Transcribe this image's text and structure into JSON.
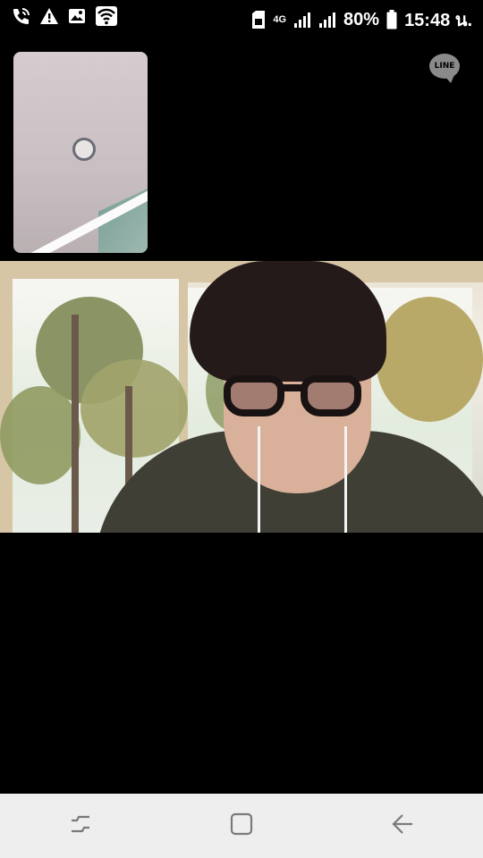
{
  "status_bar": {
    "battery_percent": "80%",
    "time": "15:48 น.",
    "network_type": "4G",
    "left_icons": [
      "wifi-calling-icon",
      "warning-icon",
      "image-icon",
      "wifi-icon"
    ],
    "right_icons": [
      "sim-icon",
      "signal-icon",
      "signal-icon",
      "battery-icon"
    ]
  },
  "call": {
    "app_logo_text": "LINE"
  },
  "navigation_bar": {
    "buttons": [
      "recent-apps-icon",
      "home-icon",
      "back-icon"
    ]
  }
}
